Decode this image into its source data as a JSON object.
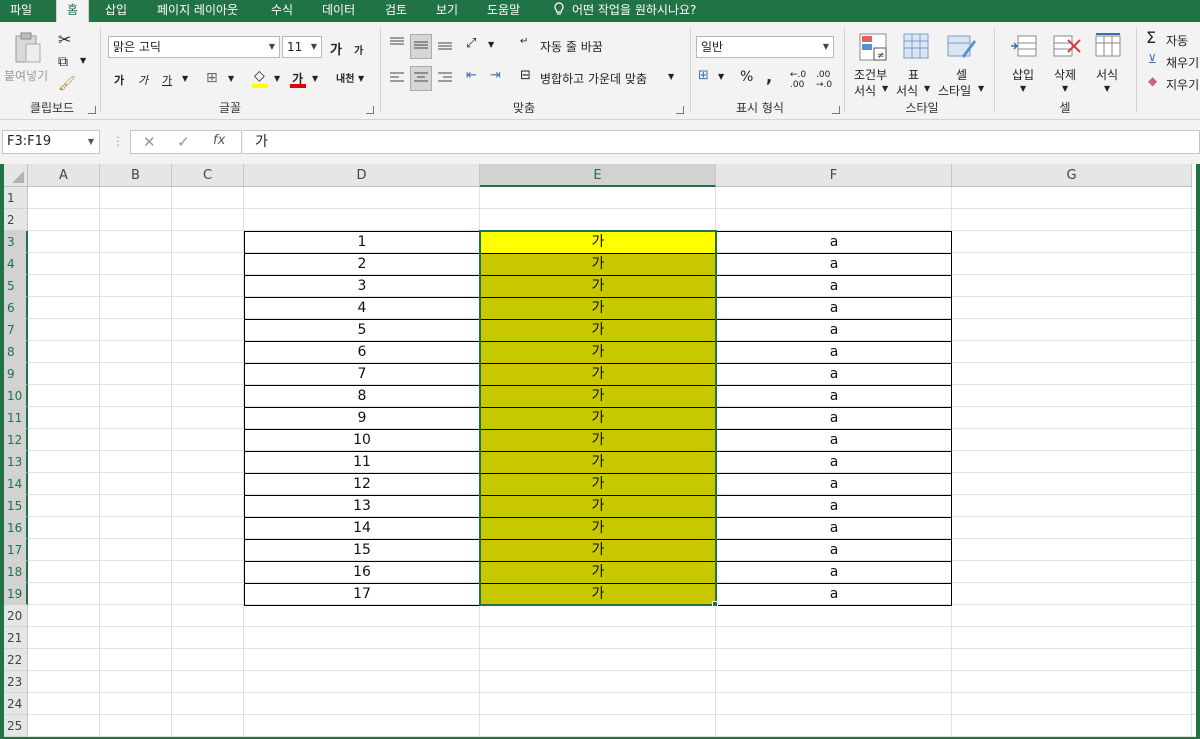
{
  "ribbon_tabs": [
    "파일",
    "홈",
    "삽입",
    "페이지 레이아웃",
    "수식",
    "데이터",
    "검토",
    "보기",
    "도움말"
  ],
  "active_tab": "홈",
  "tell_me": "어떤 작업을 원하시나요?",
  "clipboard": {
    "paste": "붙여넣기",
    "group": "클립보드"
  },
  "font": {
    "name": "맑은 고딕",
    "size": "11",
    "grow": "가",
    "shrink": "가",
    "bold": "가",
    "italic": "가",
    "underline": "가",
    "color_letter": "가",
    "phonetic": "내천",
    "group": "글꼴",
    "fill_color": "#ffff00",
    "font_color": "#e00000"
  },
  "alignment": {
    "wrap": "자동 줄 바꿈",
    "merge": "병합하고 가운데 맞춤",
    "group": "맞춤"
  },
  "number": {
    "format": "일반",
    "percent": "%",
    "comma": ",",
    "group": "표시 형식"
  },
  "styles": {
    "cond": "조건부",
    "cond2": "서식",
    "table": "표",
    "table2": "서식",
    "cell": "셀",
    "cell2": "스타일",
    "group": "스타일"
  },
  "cells": {
    "insert": "삽입",
    "delete": "삭제",
    "format": "서식",
    "group": "셀"
  },
  "editing": {
    "autosum": "자동",
    "fill": "채우기",
    "clear": "지우기"
  },
  "formula_bar": {
    "name_box": "F3:F19",
    "cancel": "✕",
    "enter": "✓",
    "fx": "fx",
    "content": "가"
  },
  "columns": [
    "A",
    "B",
    "C",
    "D",
    "E",
    "F",
    "G"
  ],
  "selected_column": "E",
  "rows": [
    "1",
    "2",
    "3",
    "4",
    "5",
    "6",
    "7",
    "8",
    "9",
    "10",
    "11",
    "12",
    "13",
    "14",
    "15",
    "16",
    "17",
    "18",
    "19",
    "20",
    "21",
    "22",
    "23",
    "24",
    "25"
  ],
  "table": {
    "d": [
      "1",
      "2",
      "3",
      "4",
      "5",
      "6",
      "7",
      "8",
      "9",
      "10",
      "11",
      "12",
      "13",
      "14",
      "15",
      "16",
      "17"
    ],
    "e": [
      "가",
      "가",
      "가",
      "가",
      "가",
      "가",
      "가",
      "가",
      "가",
      "가",
      "가",
      "가",
      "가",
      "가",
      "가",
      "가",
      "가"
    ],
    "f": [
      "a",
      "a",
      "a",
      "a",
      "a",
      "a",
      "a",
      "a",
      "a",
      "a",
      "a",
      "a",
      "a",
      "a",
      "a",
      "a",
      "a"
    ]
  },
  "colors": {
    "excel_green": "#217346",
    "active_cell_fill": "#ffff00",
    "selection_fill": "#c8c800"
  }
}
